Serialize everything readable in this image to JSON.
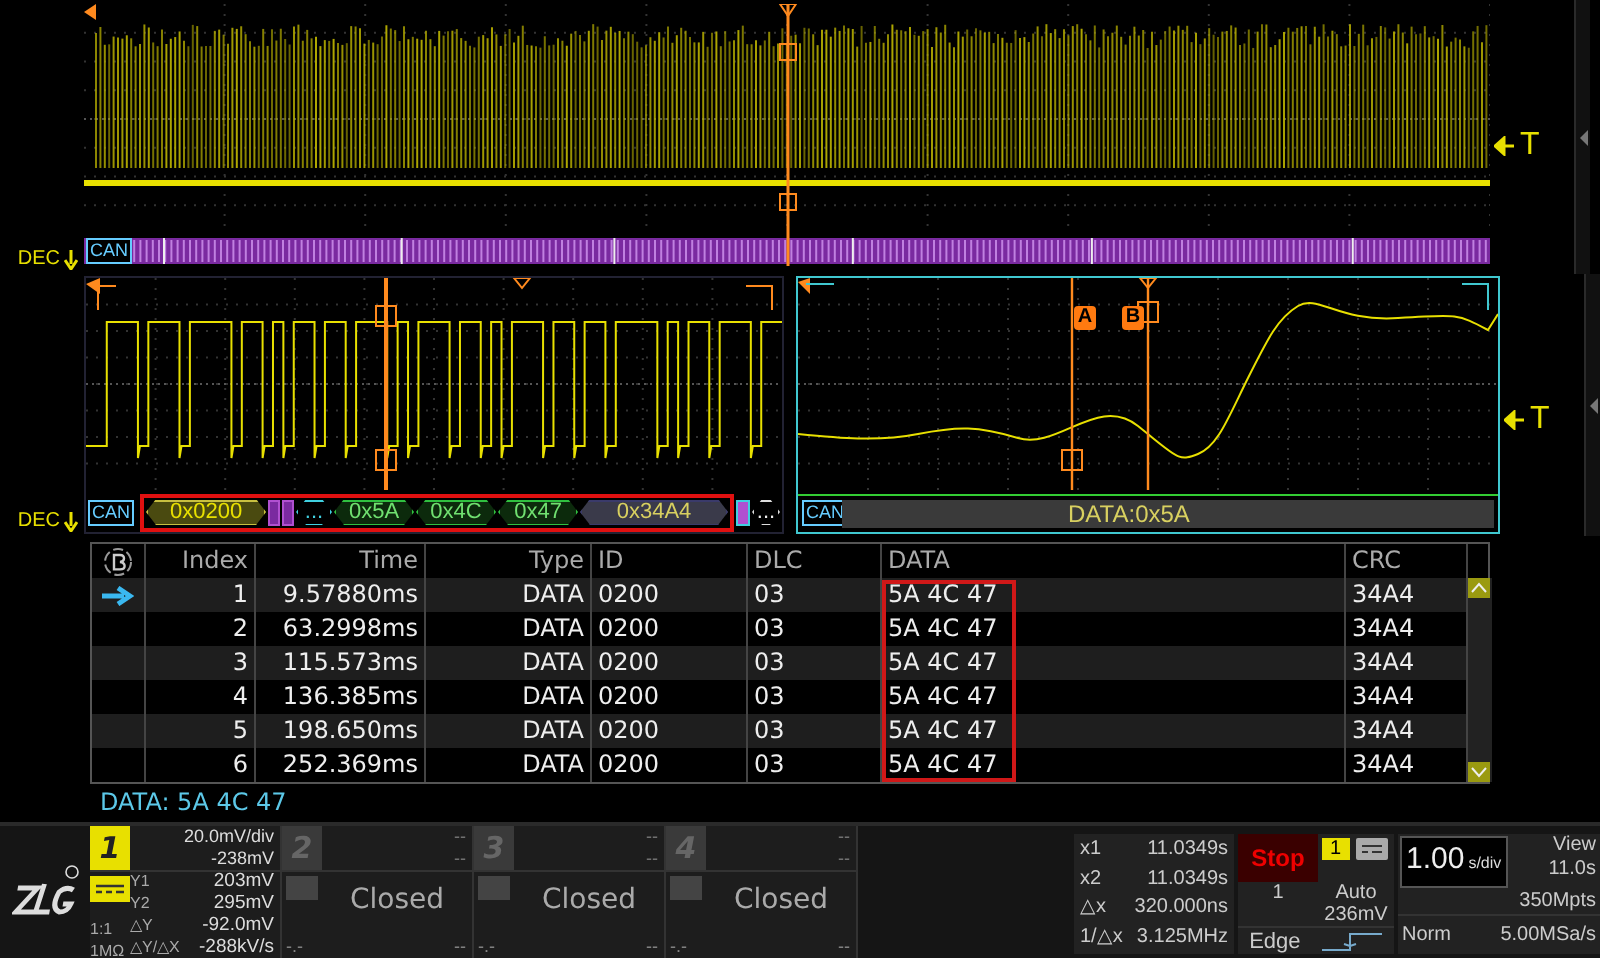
{
  "overview": {
    "bus_label": "CAN",
    "dec_label": "DEC",
    "trigger_label": "T"
  },
  "zoom_left": {
    "bus_label": "CAN",
    "dec_label": "DEC",
    "segments": [
      {
        "kind": "id",
        "text": "0x0200",
        "boxed": true
      },
      {
        "kind": "ctrl",
        "boxed": true
      },
      {
        "kind": "ctrl",
        "boxed": true
      },
      {
        "kind": "dlc",
        "text": "...",
        "boxed": true
      },
      {
        "kind": "data",
        "text": "0x5A",
        "boxed": true
      },
      {
        "kind": "data",
        "text": "0x4C",
        "boxed": true
      },
      {
        "kind": "data",
        "text": "0x47",
        "boxed": true
      },
      {
        "kind": "crc",
        "text": "0x34A4",
        "boxed": true
      },
      {
        "kind": "ack",
        "boxed": false
      },
      {
        "kind": "end",
        "text": "...",
        "boxed": false
      }
    ]
  },
  "zoom_right": {
    "bus_label": "CAN",
    "decode": "DATA:0x5A",
    "trigger_label": "T",
    "cursors": [
      {
        "label": "A"
      },
      {
        "label": "B"
      }
    ]
  },
  "table": {
    "columns": [
      {
        "label": "Index",
        "highlighted": false
      },
      {
        "label": "Time",
        "highlighted": false
      },
      {
        "label": "Type",
        "highlighted": false
      },
      {
        "label": "ID",
        "highlighted": false
      },
      {
        "label": "DLC",
        "highlighted": false
      },
      {
        "label": "DATA",
        "highlighted": true
      },
      {
        "label": "CRC",
        "highlighted": false
      }
    ],
    "rows": [
      {
        "selected": true,
        "cells": [
          "1",
          "9.57880ms",
          "DATA",
          "0200",
          "03",
          "5A 4C 47",
          "34A4"
        ]
      },
      {
        "selected": false,
        "cells": [
          "2",
          "63.2998ms",
          "DATA",
          "0200",
          "03",
          "5A 4C 47",
          "34A4"
        ]
      },
      {
        "selected": false,
        "cells": [
          "3",
          "115.573ms",
          "DATA",
          "0200",
          "03",
          "5A 4C 47",
          "34A4"
        ]
      },
      {
        "selected": false,
        "cells": [
          "4",
          "136.385ms",
          "DATA",
          "0200",
          "03",
          "5A 4C 47",
          "34A4"
        ]
      },
      {
        "selected": false,
        "cells": [
          "5",
          "198.650ms",
          "DATA",
          "0200",
          "03",
          "5A 4C 47",
          "34A4"
        ]
      },
      {
        "selected": false,
        "cells": [
          "6",
          "252.369ms",
          "DATA",
          "0200",
          "03",
          "5A 4C 47",
          "34A4"
        ]
      }
    ]
  },
  "status": "DATA: 5A 4C 47",
  "channels": [
    {
      "number": "1",
      "on": true,
      "scale": "20.0mV/div",
      "offset": "-238mV",
      "ratio": "1:1",
      "impedance": "1MΩ",
      "readouts": [
        {
          "label": "Y1",
          "value": "203mV"
        },
        {
          "label": "Y2",
          "value": "295mV"
        },
        {
          "label": "△Y",
          "value": "-92.0mV"
        },
        {
          "label": "△Y/△X",
          "value": "-288kV/s"
        }
      ]
    },
    {
      "number": "2",
      "on": false,
      "scale": "--",
      "offset": "--",
      "state": "Closed",
      "bottom_left": "-.-",
      "bottom_right": "--"
    },
    {
      "number": "3",
      "on": false,
      "scale": "--",
      "offset": "--",
      "state": "Closed",
      "bottom_left": "-.-",
      "bottom_right": "--"
    },
    {
      "number": "4",
      "on": false,
      "scale": "--",
      "offset": "--",
      "state": "Closed",
      "bottom_left": "-.-",
      "bottom_right": "--"
    }
  ],
  "cursor_readouts": [
    {
      "label": "x1",
      "value": "11.0349s"
    },
    {
      "label": "x2",
      "value": "11.0349s"
    },
    {
      "label": "△x",
      "value": "320.000ns"
    },
    {
      "label": "1/△x",
      "value": "3.125MHz"
    }
  ],
  "trigger": {
    "run_state": "Stop",
    "source": "1",
    "mode": "Auto",
    "count": "1",
    "level": "236mV",
    "type": "Edge"
  },
  "timebase": {
    "scale": "1.00",
    "unit": "s/div",
    "view_label": "View",
    "view": "11.0s",
    "memory": "350Mpts",
    "acquire": "Norm",
    "rate": "5.00MSa/s"
  }
}
